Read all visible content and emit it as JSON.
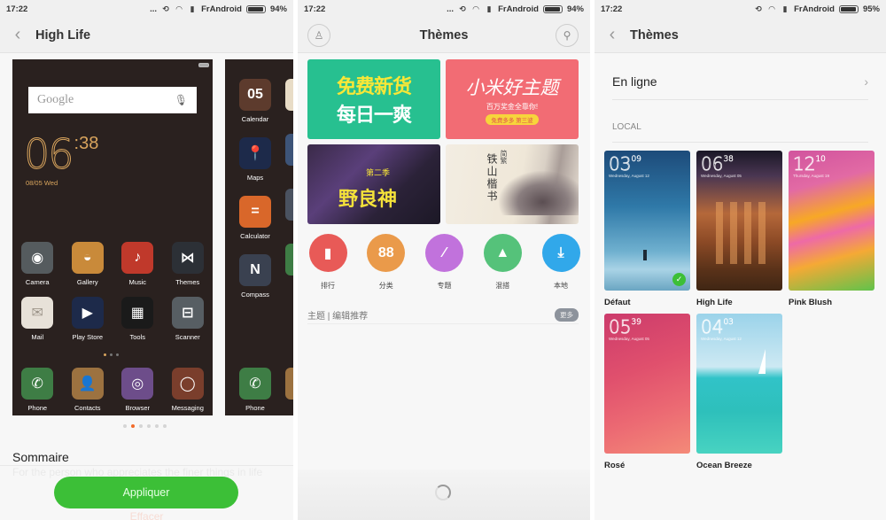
{
  "status_bars": [
    {
      "time": "17:22",
      "dots": "...",
      "carrier": "FrAndroid",
      "battery": "94%",
      "battery_level": 0.94
    },
    {
      "time": "17:22",
      "dots": "...",
      "carrier": "FrAndroid",
      "battery": "94%",
      "battery_level": 0.94
    },
    {
      "time": "17:22",
      "dots": "",
      "carrier": "FrAndroid",
      "battery": "95%",
      "battery_level": 0.95
    }
  ],
  "screen1": {
    "title": "High Life",
    "back_icon": "‹",
    "preview": {
      "search_placeholder": "Google",
      "mic_icon": "🎙",
      "clock_hours": "06",
      "clock_minutes": ":38",
      "date": "08/05  Wed",
      "apps": [
        {
          "label": "Camera",
          "glyph": "◉",
          "color": "#555b5e"
        },
        {
          "label": "Gallery",
          "glyph": "◒",
          "color": "#c98a3a"
        },
        {
          "label": "Music",
          "glyph": "♪",
          "color": "#c0392b"
        },
        {
          "label": "Themes",
          "glyph": "⋈",
          "color": "#2c3036"
        },
        {
          "label": "Mail",
          "glyph": "✉",
          "color": "#e7e1d8"
        },
        {
          "label": "Play Store",
          "glyph": "▶",
          "color": "#1d2a4a"
        },
        {
          "label": "Tools",
          "glyph": "▦",
          "color": "#1a1a1a"
        },
        {
          "label": "Scanner",
          "glyph": "⊟",
          "color": "#575e63"
        }
      ],
      "dock": [
        {
          "label": "Phone",
          "glyph": "✆",
          "color": "#3e7d45"
        },
        {
          "label": "Contacts",
          "glyph": "👤",
          "color": "#9c7240"
        },
        {
          "label": "Browser",
          "glyph": "◎",
          "color": "#6d4d8a"
        },
        {
          "label": "Messaging",
          "glyph": "◯",
          "color": "#7a3e2c"
        }
      ],
      "next_page_apps": [
        {
          "label": "Calendar",
          "glyph": "05",
          "color": "#5d3b2d"
        },
        {
          "label": "Maps",
          "glyph": "📍",
          "color": "#1d2a4a"
        },
        {
          "label": "Calculator",
          "glyph": "=",
          "color": "#d9672a"
        },
        {
          "label": "Compass",
          "glyph": "N",
          "color": "#3a4150"
        }
      ],
      "next_page_dock": [
        {
          "label": "Phone",
          "glyph": "✆",
          "color": "#3e7d45"
        }
      ]
    },
    "carousel_pages": 6,
    "carousel_active": 1,
    "summary_title": "Sommaire",
    "summary_desc": "For the person who appreciates the finer things in life",
    "apply_label": "Appliquer",
    "erase_label": "Effacer"
  },
  "screen2": {
    "title": "Thèmes",
    "profile_icon": "♙",
    "search_icon": "⚲",
    "banners": [
      {
        "line1": "免费新货",
        "line2": "每日一爽"
      },
      {
        "line1": "小米好主题",
        "line2": "百万奖金全靠你!",
        "pill": "免费多多  第三波"
      },
      {
        "line1": "野良神",
        "line2": "第二季"
      },
      {
        "line1": "铁山楷书",
        "line2": "简繁"
      }
    ],
    "categories": [
      {
        "label": "排行",
        "glyph": "▮",
        "color": "#e85a57"
      },
      {
        "label": "分类",
        "glyph": "88",
        "color": "#ea9a4a"
      },
      {
        "label": "专题",
        "glyph": "⁄",
        "color": "#c172dc"
      },
      {
        "label": "混搭",
        "glyph": "▲",
        "color": "#55c27a"
      },
      {
        "label": "本地",
        "glyph": "⤓",
        "color": "#31a8ea"
      }
    ],
    "section_title": "主题 | 编辑推荐",
    "more_label": "更多"
  },
  "screen3": {
    "title": "Thèmes",
    "back_icon": "‹",
    "online_label": "En ligne",
    "chevron": "›",
    "local_label": "LOCAL",
    "themes": [
      {
        "name": "Défaut",
        "hour": "03",
        "min": "09",
        "date": "Wednesday, August 12",
        "selected": true
      },
      {
        "name": "High Life",
        "hour": "06",
        "min": "38",
        "date": "Wednesday, August 05",
        "selected": false
      },
      {
        "name": "Pink Blush",
        "hour": "12",
        "min": "10",
        "date": "Thursday, August 19",
        "selected": false
      },
      {
        "name": "Rosé",
        "hour": "05",
        "min": "39",
        "date": "Wednesday, August 05",
        "selected": false
      },
      {
        "name": "Ocean Breeze",
        "hour": "04",
        "min": "03",
        "date": "Wednesday, August 12",
        "selected": false
      }
    ],
    "check_icon": "✓"
  }
}
